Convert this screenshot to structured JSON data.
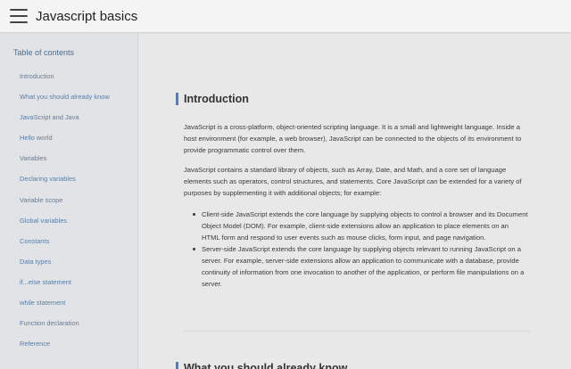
{
  "header": {
    "menu_icon": "hamburger-menu-icon",
    "title": "Javascript basics"
  },
  "sidebar": {
    "heading": "Table of contents",
    "items": [
      {
        "label": "Introduction"
      },
      {
        "label": "What you should already know"
      },
      {
        "label": "JavaScript and Java"
      },
      {
        "label": "Hello world"
      },
      {
        "label": "Variables"
      },
      {
        "label": "Declaring variables"
      },
      {
        "label": "Variable scope"
      },
      {
        "label": "Global variables"
      },
      {
        "label": "Constants"
      },
      {
        "label": "Data types"
      },
      {
        "label": "if...else statement"
      },
      {
        "label": "while statement"
      },
      {
        "label": "Function declaration"
      },
      {
        "label": "Reference"
      }
    ]
  },
  "main": {
    "section_title": "Introduction",
    "paragraph1": "JavaScript is a cross-platform, object-oriented scripting language. It is a small and lightweight language. Inside a host environment (for example, a web browser), JavaScript can be connected to the objects of its environment to provide programmatic control over them.",
    "paragraph2": "JavaScript contains a standard library of objects, such as Array, Date, and Math, and a core set of language elements such as operators, control structures, and statements. Core JavaScript can be extended for a variety of purposes by supplementing it with additional objects; for example:",
    "bullets": [
      {
        "text": "Client-side JavaScript extends the core language by supplying objects to control a browser and its Document Object Model (DOM). For example, client-side extensions allow an application to place elements on an HTML form and respond to user events such as mouse clicks, form input, and page navigation."
      },
      {
        "text": "Server-side JavaScript extends the core language by supplying objects relevant to running JavaScript on a server. For example, server-side extensions allow an application to communicate with a database, provide continuity of information from one invocation to another of the application, or perform file manipulations on a server."
      }
    ],
    "next_section_title": "What you should already know"
  },
  "colors": {
    "accent": "#4a7fc8",
    "link": "#5b7ea2",
    "sidebar_bg": "#e2e3e6",
    "page_bg": "#e8e8e8"
  }
}
